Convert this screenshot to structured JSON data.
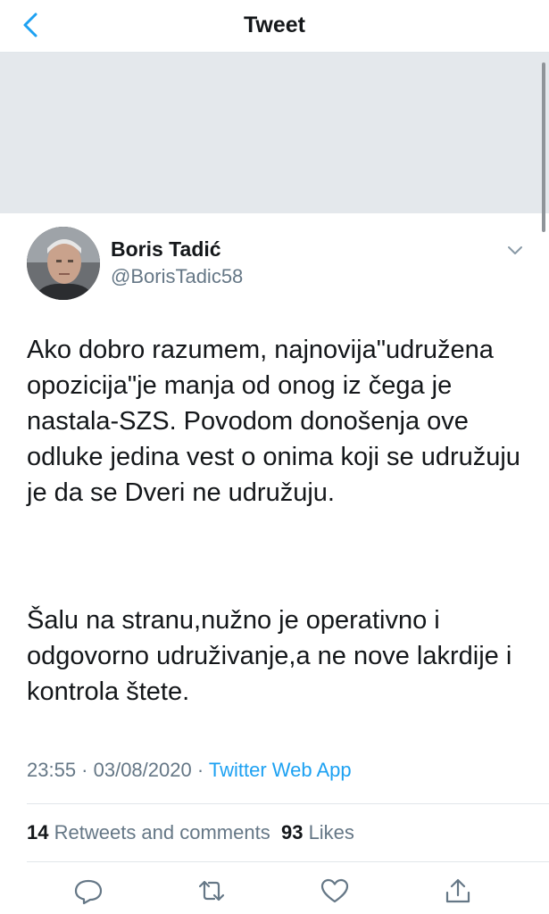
{
  "nav": {
    "title": "Tweet",
    "back_icon": "chevron-left-icon"
  },
  "tweet": {
    "author_name": "Boris Tadić",
    "author_handle": "@BorisTadic58",
    "paragraphs": [
      "Ako dobro razumem, najnovija\"udružena opozicija\"je manja od onog iz čega je nastala-SZS. Povodom donošenja ove odluke jedina vest o onima koji se udružuju je da se Dveri ne udružuju.",
      "Šalu na stranu,nužno je operativno i odgovorno udruživanje,a ne nove lakrdije i kontrola štete."
    ],
    "timestamp": "23:55 · 03/08/2020 ·",
    "source": "Twitter Web App"
  },
  "stats": {
    "retweets_count": "14",
    "retweets_label": "Retweets and comments",
    "likes_count": "93",
    "likes_label": "Likes"
  },
  "actions": [
    "reply-icon",
    "retweet-icon",
    "like-icon",
    "share-icon"
  ],
  "colors": {
    "accent": "#1da1f2",
    "secondary_text": "#657786",
    "banner": "#e4e8ec"
  }
}
